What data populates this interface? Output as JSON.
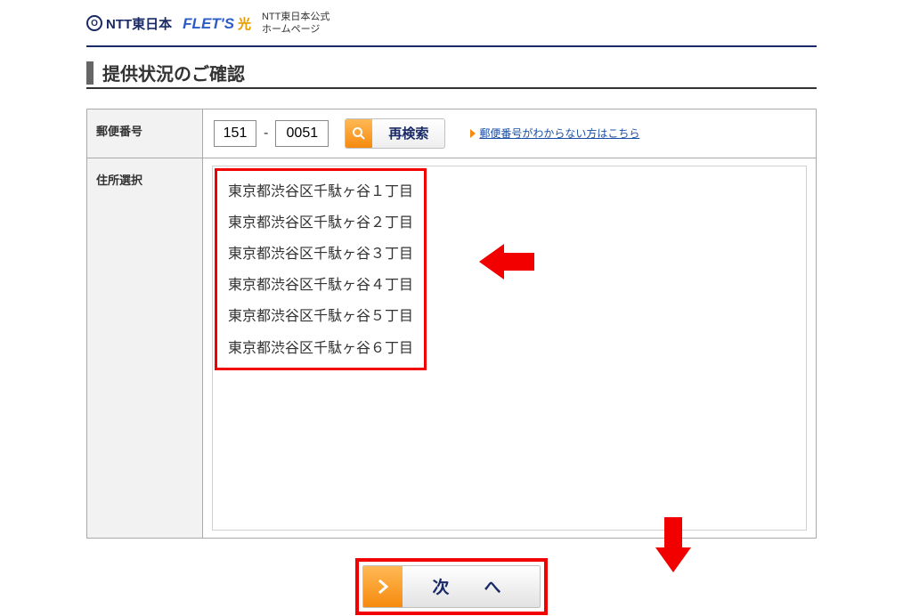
{
  "header": {
    "ntt_logo": "NTT東日本",
    "flets_logo": "FLET'S",
    "hikari": "光",
    "subtext_line1": "NTT東日本公式",
    "subtext_line2": "ホームページ"
  },
  "title": "提供状況のご確認",
  "form": {
    "zip_label": "郵便番号",
    "zip_part1": "151",
    "zip_part2": "0051",
    "search_button": "再検索",
    "help_link": "郵便番号がわからない方はこちら",
    "address_label": "住所選択",
    "address_list": [
      "東京都渋谷区千駄ヶ谷１丁目",
      "東京都渋谷区千駄ヶ谷２丁目",
      "東京都渋谷区千駄ヶ谷３丁目",
      "東京都渋谷区千駄ヶ谷４丁目",
      "東京都渋谷区千駄ヶ谷５丁目",
      "東京都渋谷区千駄ヶ谷６丁目"
    ]
  },
  "next_button": "次　へ"
}
